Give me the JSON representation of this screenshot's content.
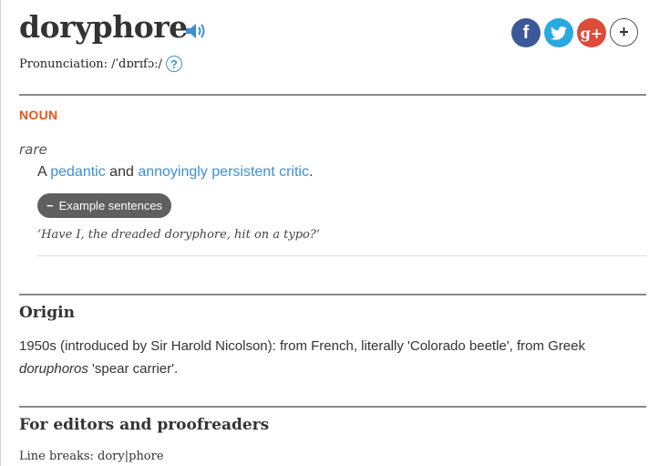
{
  "entry": {
    "headword": "doryphore",
    "pronunciation_label": "Pronunciation:",
    "pronunciation": "/ˈdɒrɪfɔː/",
    "help_symbol": "?",
    "audio_icon": "speaker-icon"
  },
  "share": {
    "facebook": "f",
    "twitter_icon": "twitter-bird-icon",
    "google": "g+",
    "more": "+"
  },
  "sense": {
    "part_of_speech": "NOUN",
    "register": "rare",
    "def_prefix": "A ",
    "def_link1": "pedantic",
    "def_mid": " and ",
    "def_link2": "annoyingly persistent critic",
    "def_suffix": ".",
    "examples_button": "Example sentences",
    "example": "‘Have I, the dreaded doryphore, hit on a typo?’"
  },
  "origin": {
    "title": "Origin",
    "text_before": "1950s (introduced by Sir Harold Nicolson): from French, literally 'Colorado beetle', from Greek ",
    "text_italic": "doruphoros",
    "text_after": " 'spear carrier'."
  },
  "editors": {
    "title": "For editors and proofreaders",
    "line_breaks": "Line breaks: dory|phore"
  },
  "colors": {
    "accent": "#e6551c",
    "link": "#3d8fd5",
    "facebook": "#3b5998",
    "twitter": "#29a9e1",
    "google": "#dd4b39"
  }
}
